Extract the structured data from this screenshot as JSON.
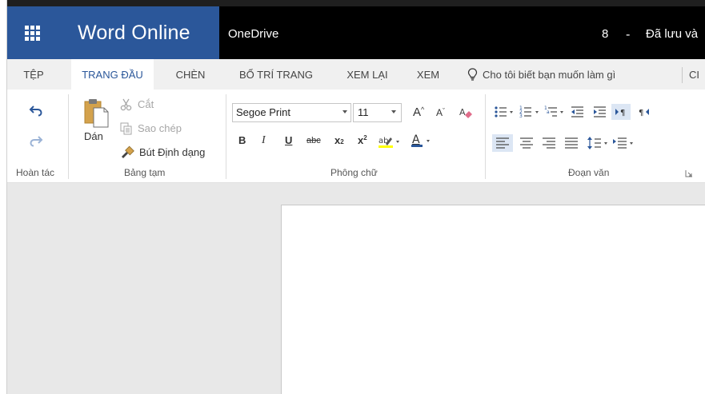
{
  "titlebar": {
    "app_name": "Word Online",
    "onedrive_label": "OneDrive",
    "doc_name": "8",
    "separator": "-",
    "status": "Đã lưu và"
  },
  "tabs": [
    {
      "label": "TỆP"
    },
    {
      "label": "TRANG ĐẦU"
    },
    {
      "label": "CHÈN"
    },
    {
      "label": "BỐ TRÍ TRANG"
    },
    {
      "label": "XEM LẠI"
    },
    {
      "label": "XEM"
    }
  ],
  "tell_me": "Cho tôi biết bạn muốn làm gì",
  "tab_cut": "CI",
  "ribbon": {
    "undo_group": {
      "label": "Hoàn tác"
    },
    "clipboard": {
      "label": "Bảng tạm",
      "paste": "Dán",
      "cut": "Cắt",
      "copy": "Sao chép",
      "format_painter": "Bút Định dạng"
    },
    "font": {
      "label": "Phông chữ",
      "font_name": "Segoe Print",
      "font_size": "11",
      "bold": "B",
      "italic": "I",
      "underline": "U",
      "strike": "abc",
      "subscript": "x",
      "superscript": "x"
    },
    "paragraph": {
      "label": "Đoạn văn"
    }
  },
  "colors": {
    "brand": "#2b579a",
    "titlebar": "#000000",
    "highlight": "#dce6f4"
  }
}
